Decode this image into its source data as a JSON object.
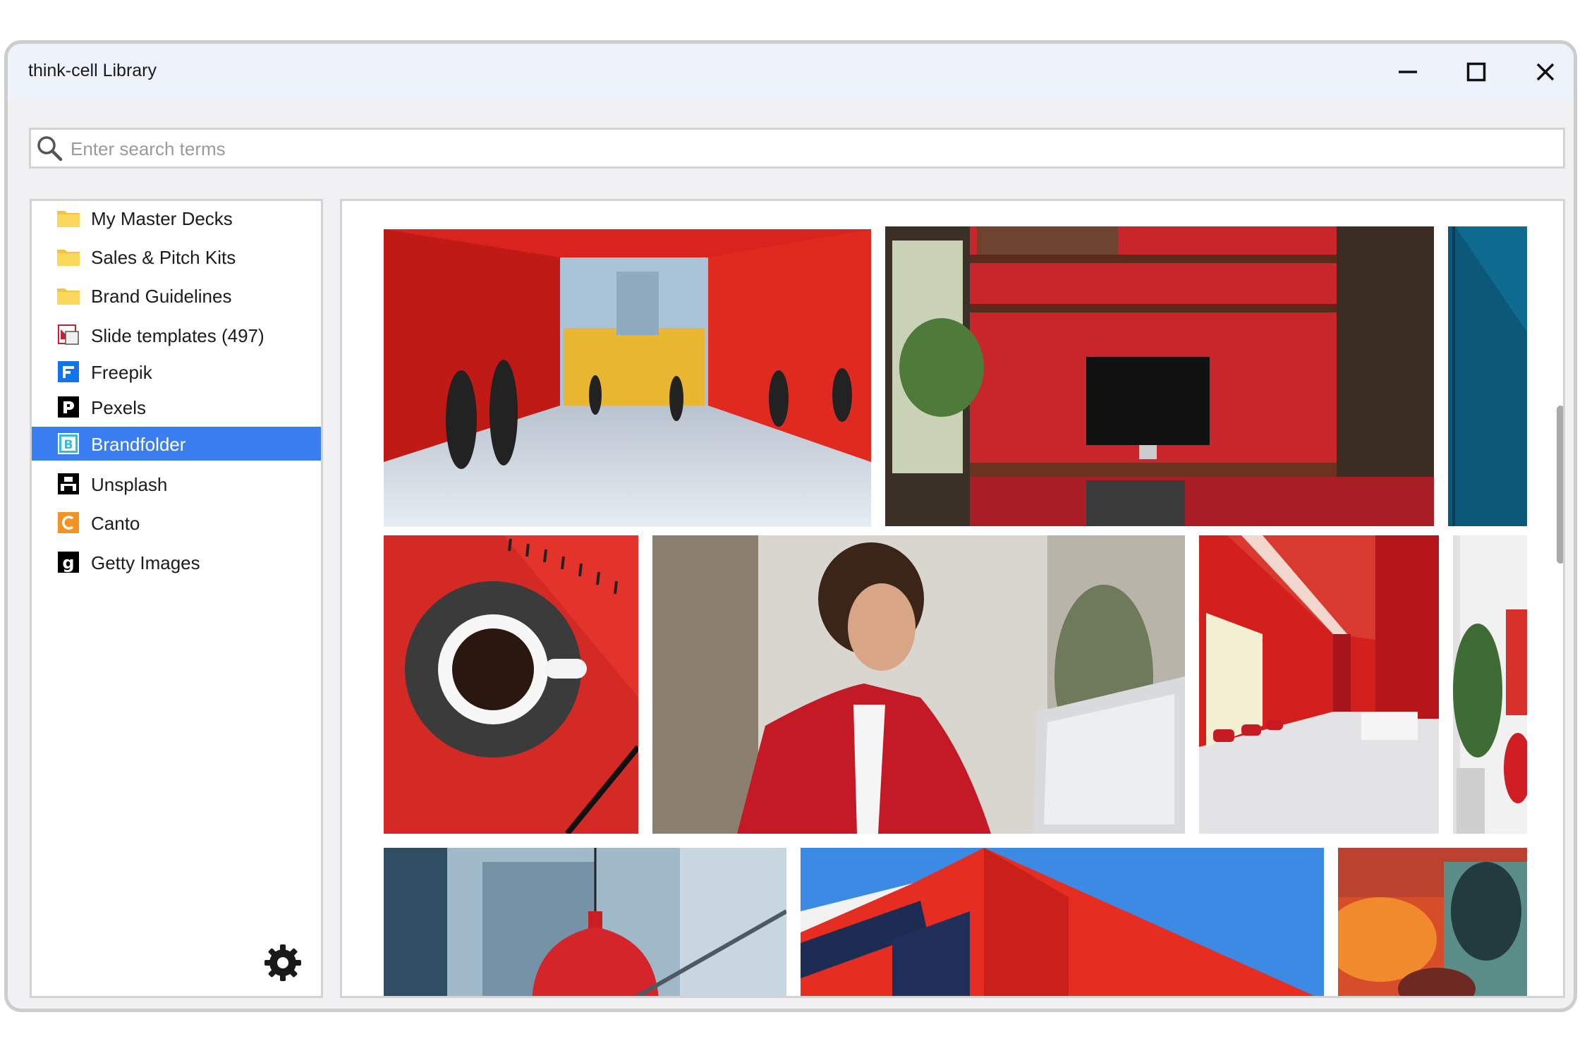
{
  "window": {
    "title": "think-cell Library",
    "minimize_icon": "minimize-icon",
    "maximize_icon": "maximize-icon",
    "close_icon": "close-icon"
  },
  "search": {
    "placeholder": "Enter search terms",
    "value": "",
    "icon": "search-icon"
  },
  "sidebar": {
    "items": [
      {
        "label": "My Master Decks",
        "icon": "folder-icon"
      },
      {
        "label": "Sales & Pitch Kits",
        "icon": "folder-icon"
      },
      {
        "label": "Brand Guidelines",
        "icon": "folder-icon"
      },
      {
        "label": "Slide templates (497)",
        "icon": "slide-templates-icon"
      },
      {
        "label": "Freepik",
        "icon": "freepik-icon"
      },
      {
        "label": "Pexels",
        "icon": "pexels-icon"
      },
      {
        "label": "Brandfolder",
        "icon": "brandfolder-icon",
        "selected": true
      },
      {
        "label": "Unsplash",
        "icon": "unsplash-icon"
      },
      {
        "label": "Canto",
        "icon": "canto-icon"
      },
      {
        "label": "Getty Images",
        "icon": "getty-images-icon"
      }
    ],
    "settings_icon": "gear-icon"
  },
  "gallery": {
    "images": [
      "red-lobby-walkers-image",
      "red-office-desk-image",
      "blue-wall-image",
      "coffee-notebook-image",
      "woman-red-blazer-laptop-image",
      "red-hallway-interior-image",
      "white-office-plant-image",
      "red-pendant-lamp-image",
      "red-building-sky-image",
      "blurred-silhouette-image"
    ]
  },
  "colors": {
    "accent": "#3a7ef2",
    "selected_text": "#ffffff",
    "window_border": "#cdcdcd",
    "titlebar": "#eef2fa"
  }
}
